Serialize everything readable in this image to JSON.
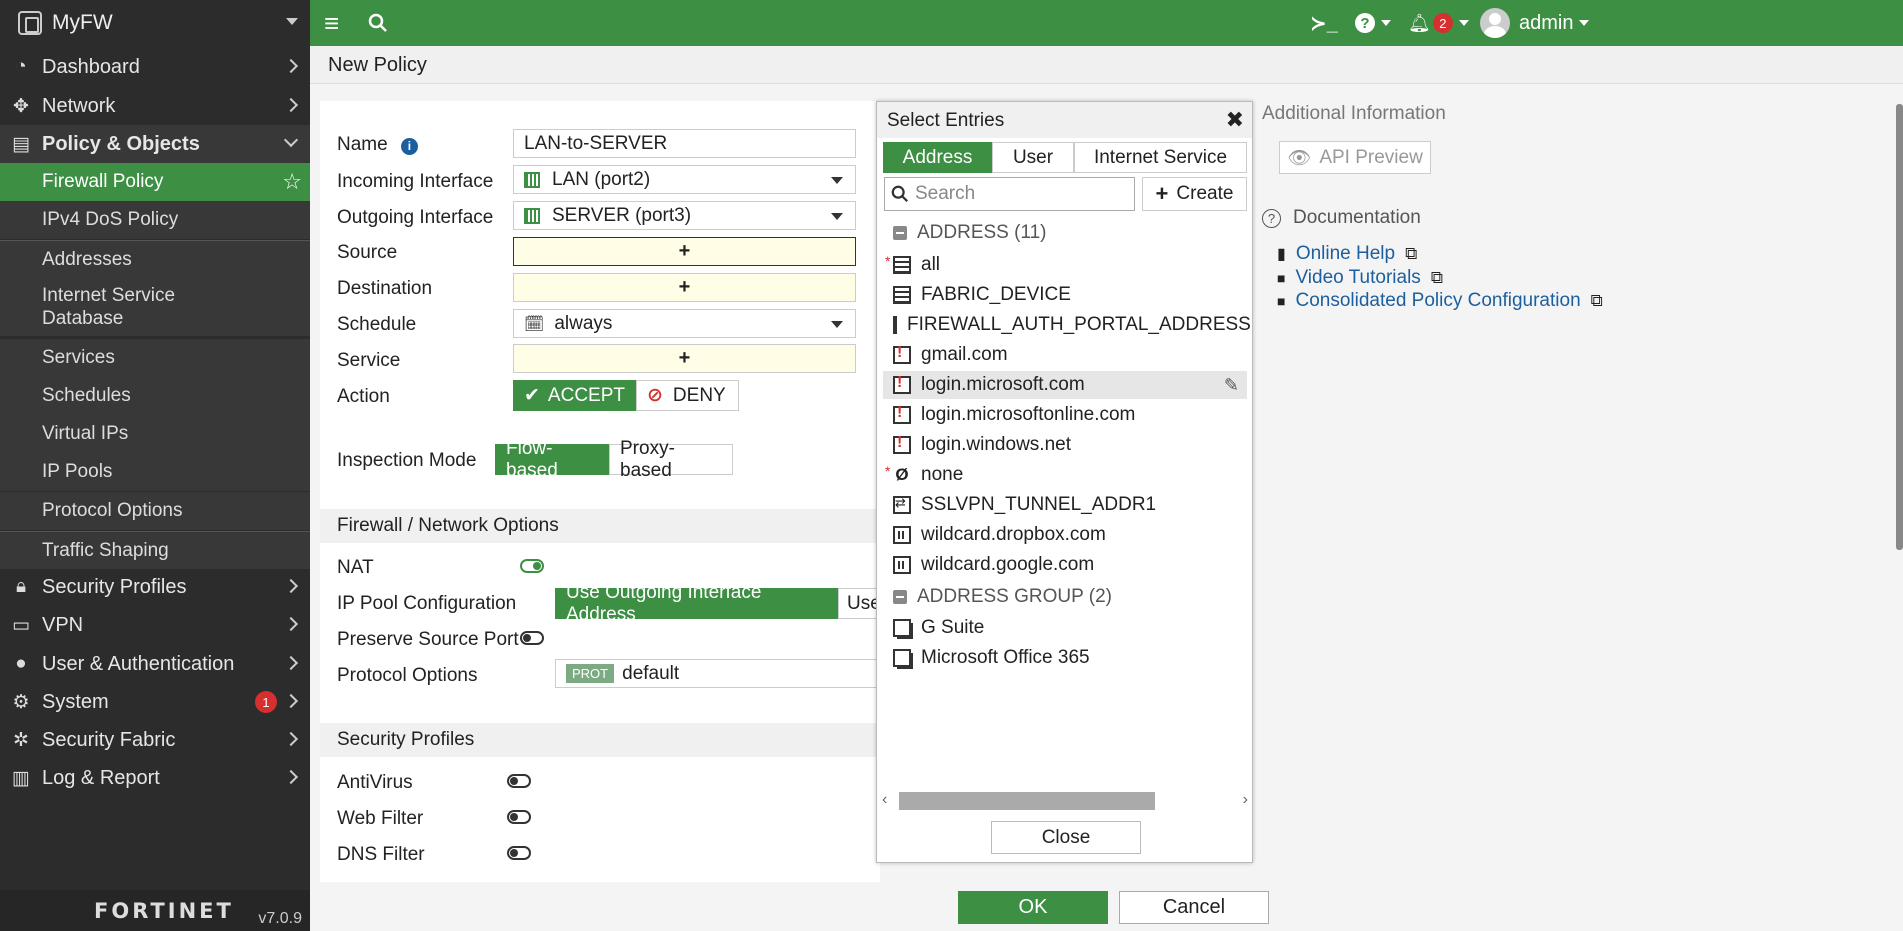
{
  "app": {
    "name": "MyFW",
    "vendor": "FORTINET",
    "version": "v7.0.9"
  },
  "sidebar": {
    "items": [
      {
        "label": "Dashboard",
        "icon": "dashboard-icon"
      },
      {
        "label": "Network",
        "icon": "network-icon"
      },
      {
        "label": "Policy & Objects",
        "icon": "policy-icon"
      },
      {
        "label": "Security Profiles",
        "icon": "lock-icon"
      },
      {
        "label": "VPN",
        "icon": "laptop-icon"
      },
      {
        "label": "User & Authentication",
        "icon": "user-icon"
      },
      {
        "label": "System",
        "icon": "gear-icon",
        "badge": "1"
      },
      {
        "label": "Security Fabric",
        "icon": "fabric-icon"
      },
      {
        "label": "Log & Report",
        "icon": "chart-icon"
      }
    ],
    "policy_subitems": [
      "Firewall Policy",
      "IPv4 DoS Policy",
      "Addresses",
      "Internet Service Database",
      "Services",
      "Schedules",
      "Virtual IPs",
      "IP Pools",
      "Protocol Options",
      "Traffic Shaping"
    ]
  },
  "topbar": {
    "notifications": "2",
    "user": "admin"
  },
  "page": {
    "title": "New Policy"
  },
  "form": {
    "name_label": "Name",
    "name_value": "LAN-to-SERVER",
    "incoming_label": "Incoming Interface",
    "incoming_value": "LAN (port2)",
    "outgoing_label": "Outgoing Interface",
    "outgoing_value": "SERVER (port3)",
    "source_label": "Source",
    "destination_label": "Destination",
    "schedule_label": "Schedule",
    "schedule_value": "always",
    "service_label": "Service",
    "action_label": "Action",
    "accept": "ACCEPT",
    "deny": "DENY",
    "inspection_label": "Inspection Mode",
    "flow_based": "Flow-based",
    "proxy_based": "Proxy-based",
    "fw_section": "Firewall / Network Options",
    "nat_label": "NAT",
    "ippool_label": "IP Pool Configuration",
    "ippool_opt1": "Use Outgoing Interface Address",
    "ippool_opt2": "Use",
    "preserve_label": "Preserve Source Port",
    "protocol_label": "Protocol Options",
    "protocol_tag": "PROT",
    "protocol_value": "default",
    "sec_section": "Security Profiles",
    "antivirus": "AntiVirus",
    "webfilter": "Web Filter",
    "dnsfilter": "DNS Filter",
    "plus": "+"
  },
  "popup": {
    "title": "Select Entries",
    "tabs": [
      "Address",
      "User",
      "Internet Service"
    ],
    "search_placeholder": "Search",
    "create": "Create",
    "group1": "ADDRESS (11)",
    "group2": "ADDRESS GROUP (2)",
    "entries": [
      "all",
      "FABRIC_DEVICE",
      "FIREWALL_AUTH_PORTAL_ADDRESS",
      "gmail.com",
      "login.microsoft.com",
      "login.microsoftonline.com",
      "login.windows.net",
      "none",
      "SSLVPN_TUNNEL_ADDR1",
      "wildcard.dropbox.com",
      "wildcard.google.com"
    ],
    "group_entries": [
      "G Suite",
      "Microsoft Office 365"
    ],
    "close": "Close"
  },
  "info": {
    "title": "Additional Information",
    "api_preview": "API Preview",
    "documentation": "Documentation",
    "links": [
      "Online Help",
      "Video Tutorials",
      "Consolidated Policy Configuration"
    ]
  },
  "footer": {
    "ok": "OK",
    "cancel": "Cancel"
  }
}
